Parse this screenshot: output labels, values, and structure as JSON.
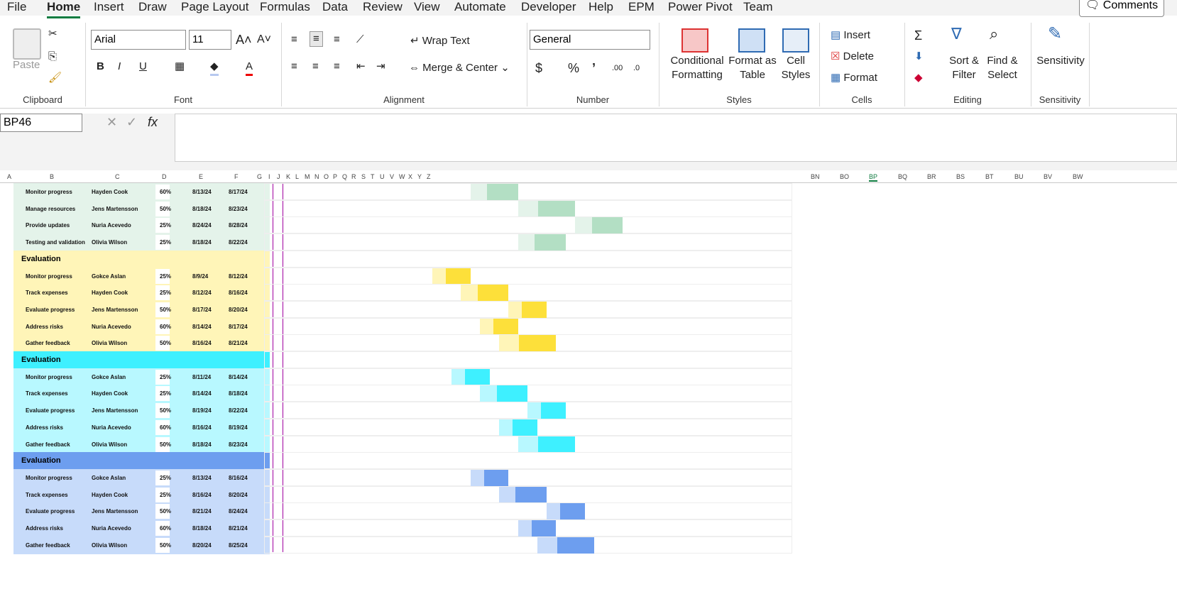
{
  "menu": [
    "File",
    "Home",
    "Insert",
    "Draw",
    "Page Layout",
    "Formulas",
    "Data",
    "Review",
    "View",
    "Automate",
    "Developer",
    "Help",
    "EPM",
    "Power Pivot",
    "Team"
  ],
  "comments_label": "Comments",
  "ribbon": {
    "clipboard": {
      "label": "Clipboard",
      "paste": "Paste"
    },
    "font": {
      "label": "Font",
      "family": "Arial",
      "size": "11"
    },
    "alignment": {
      "label": "Alignment",
      "wrap": "Wrap Text",
      "merge": "Merge & Center"
    },
    "number": {
      "label": "Number",
      "format": "General"
    },
    "styles": {
      "label": "Styles",
      "cond": "Conditional Formatting",
      "table": "Format as Table",
      "cell": "Cell Styles"
    },
    "cells": {
      "label": "Cells",
      "insert": "Insert",
      "delete": "Delete",
      "format": "Format"
    },
    "editing": {
      "label": "Editing",
      "sort": "Sort & Filter",
      "find": "Find & Select"
    },
    "sensitivity": {
      "label": "Sensitivity",
      "btn": "Sensitivity"
    }
  },
  "namebox": "BP46",
  "fx": "fx",
  "columns": [
    "A",
    "B",
    "C",
    "D",
    "E",
    "F",
    "G",
    "I",
    "J",
    "K",
    "L",
    "M",
    "N",
    "O",
    "P",
    "Q",
    "R",
    "S",
    "T",
    "U",
    "V",
    "W",
    "X",
    "Y",
    "Z",
    "BN",
    "BO",
    "BP",
    "BQ",
    "BR",
    "BS",
    "BT",
    "BU",
    "BV",
    "BW"
  ],
  "selected_column": "BP",
  "colors": {
    "green": "#b3dfc4",
    "green_light": "#e4f3ea",
    "yellow": "#fde03a",
    "yellow_light": "#fff5b8",
    "cyan": "#3ef0ff",
    "cyan_light": "#b8f8ff",
    "blue": "#6d9eef",
    "blue_light": "#c7dbfa"
  },
  "rows": [
    {
      "task": "Monitor progress",
      "owner": "Hayden Cook",
      "pct": "60%",
      "start": "8/13/24",
      "end": "8/17/24",
      "group": "green"
    },
    {
      "task": "Manage resources",
      "owner": "Jens Martensson",
      "pct": "50%",
      "start": "8/18/24",
      "end": "8/23/24",
      "group": "green"
    },
    {
      "task": "Provide updates",
      "owner": "Nuria Acevedo",
      "pct": "25%",
      "start": "8/24/24",
      "end": "8/28/24",
      "group": "green"
    },
    {
      "task": "Testing and validation",
      "owner": "Olivia Wilson",
      "pct": "25%",
      "start": "8/18/24",
      "end": "8/22/24",
      "group": "green"
    },
    {
      "section": "Evaluation",
      "group": "yellow"
    },
    {
      "task": "Monitor progress",
      "owner": "Gokce Aslan",
      "pct": "25%",
      "start": "8/9/24",
      "end": "8/12/24",
      "group": "yellow"
    },
    {
      "task": "Track expenses",
      "owner": "Hayden Cook",
      "pct": "25%",
      "start": "8/12/24",
      "end": "8/16/24",
      "group": "yellow"
    },
    {
      "task": "Evaluate progress",
      "owner": "Jens Martensson",
      "pct": "50%",
      "start": "8/17/24",
      "end": "8/20/24",
      "group": "yellow"
    },
    {
      "task": "Address risks",
      "owner": "Nuria Acevedo",
      "pct": "60%",
      "start": "8/14/24",
      "end": "8/17/24",
      "group": "yellow"
    },
    {
      "task": "Gather feedback",
      "owner": "Olivia Wilson",
      "pct": "50%",
      "start": "8/16/24",
      "end": "8/21/24",
      "group": "yellow"
    },
    {
      "section": "Evaluation",
      "group": "cyan"
    },
    {
      "task": "Monitor progress",
      "owner": "Gokce Aslan",
      "pct": "25%",
      "start": "8/11/24",
      "end": "8/14/24",
      "group": "cyan"
    },
    {
      "task": "Track expenses",
      "owner": "Hayden Cook",
      "pct": "25%",
      "start": "8/14/24",
      "end": "8/18/24",
      "group": "cyan"
    },
    {
      "task": "Evaluate progress",
      "owner": "Jens Martensson",
      "pct": "50%",
      "start": "8/19/24",
      "end": "8/22/24",
      "group": "cyan"
    },
    {
      "task": "Address risks",
      "owner": "Nuria Acevedo",
      "pct": "60%",
      "start": "8/16/24",
      "end": "8/19/24",
      "group": "cyan"
    },
    {
      "task": "Gather feedback",
      "owner": "Olivia Wilson",
      "pct": "50%",
      "start": "8/18/24",
      "end": "8/23/24",
      "group": "cyan"
    },
    {
      "section": "Evaluation",
      "group": "blue"
    },
    {
      "task": "Monitor progress",
      "owner": "Gokce Aslan",
      "pct": "25%",
      "start": "8/13/24",
      "end": "8/16/24",
      "group": "blue"
    },
    {
      "task": "Track expenses",
      "owner": "Hayden Cook",
      "pct": "25%",
      "start": "8/16/24",
      "end": "8/20/24",
      "group": "blue"
    },
    {
      "task": "Evaluate progress",
      "owner": "Jens Martensson",
      "pct": "50%",
      "start": "8/21/24",
      "end": "8/24/24",
      "group": "blue"
    },
    {
      "task": "Address risks",
      "owner": "Nuria Acevedo",
      "pct": "60%",
      "start": "8/18/24",
      "end": "8/21/24",
      "group": "blue"
    },
    {
      "task": "Gather feedback",
      "owner": "Olivia Wilson",
      "pct": "50%",
      "start": "8/20/24",
      "end": "8/25/24",
      "group": "blue"
    }
  ]
}
